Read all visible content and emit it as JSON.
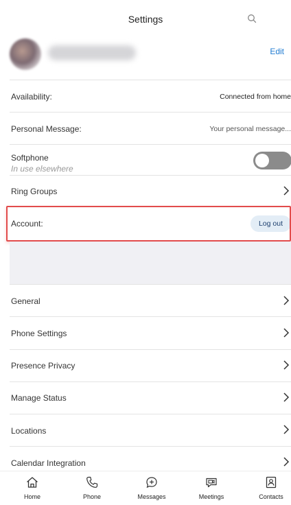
{
  "header": {
    "title": "Settings",
    "search_icon": "search-icon"
  },
  "profile": {
    "edit_label": "Edit"
  },
  "rows": {
    "availability": {
      "label": "Availability:",
      "value": "Connected from home"
    },
    "personal_message": {
      "label": "Personal Message:",
      "value": "Your personal message..."
    },
    "softphone": {
      "label": "Softphone",
      "sub": "In use elsewhere",
      "toggle_on": false
    },
    "ring_groups": {
      "label": "Ring Groups"
    },
    "account": {
      "label": "Account:",
      "logout_label": "Log out"
    },
    "general": {
      "label": "General"
    },
    "phone_settings": {
      "label": "Phone Settings"
    },
    "presence_privacy": {
      "label": "Presence Privacy"
    },
    "manage_status": {
      "label": "Manage Status"
    },
    "locations": {
      "label": "Locations"
    },
    "calendar_integration": {
      "label": "Calendar Integration"
    }
  },
  "tabbar": {
    "items": [
      {
        "label": "Home",
        "icon": "home-icon"
      },
      {
        "label": "Phone",
        "icon": "phone-icon"
      },
      {
        "label": "Messages",
        "icon": "messages-icon"
      },
      {
        "label": "Meetings",
        "icon": "meetings-icon"
      },
      {
        "label": "Contacts",
        "icon": "contacts-icon"
      }
    ]
  },
  "colors": {
    "accent": "#1f7bd1",
    "highlight": "#e24b4b",
    "logout_bg": "#e3edf6",
    "toggle_off": "#8b8b8b"
  }
}
